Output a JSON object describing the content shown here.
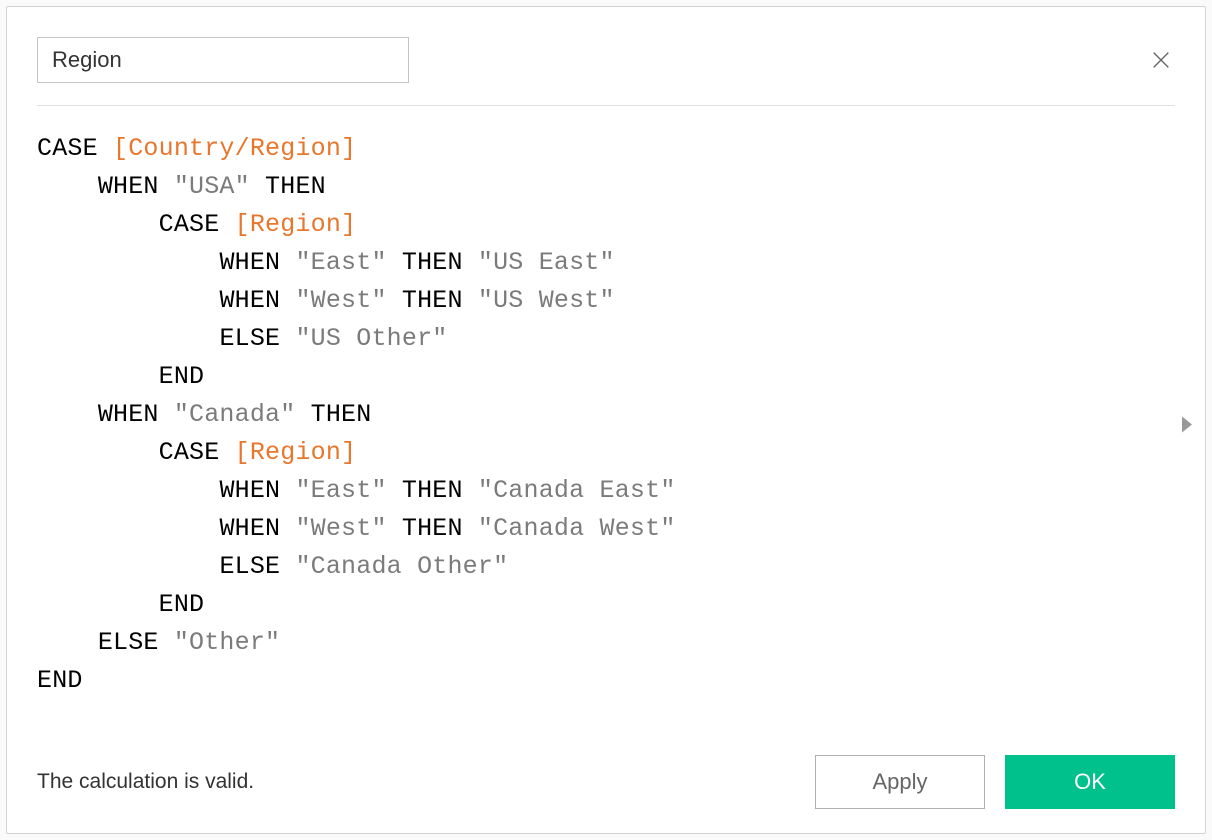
{
  "calc_name": "Region",
  "formula": {
    "lines": [
      {
        "indent": 0,
        "tokens": [
          {
            "t": "kw",
            "v": "CASE "
          },
          {
            "t": "field",
            "v": "[Country/Region]"
          }
        ]
      },
      {
        "indent": 1,
        "tokens": [
          {
            "t": "kw",
            "v": "WHEN "
          },
          {
            "t": "str",
            "v": "\"USA\""
          },
          {
            "t": "kw",
            "v": " THEN"
          }
        ]
      },
      {
        "indent": 2,
        "tokens": [
          {
            "t": "kw",
            "v": "CASE "
          },
          {
            "t": "field",
            "v": "[Region]"
          }
        ]
      },
      {
        "indent": 3,
        "tokens": [
          {
            "t": "kw",
            "v": "WHEN "
          },
          {
            "t": "str",
            "v": "\"East\""
          },
          {
            "t": "kw",
            "v": " THEN "
          },
          {
            "t": "str",
            "v": "\"US East\""
          }
        ]
      },
      {
        "indent": 3,
        "tokens": [
          {
            "t": "kw",
            "v": "WHEN "
          },
          {
            "t": "str",
            "v": "\"West\""
          },
          {
            "t": "kw",
            "v": " THEN "
          },
          {
            "t": "str",
            "v": "\"US West\""
          }
        ]
      },
      {
        "indent": 3,
        "tokens": [
          {
            "t": "kw",
            "v": "ELSE "
          },
          {
            "t": "str",
            "v": "\"US Other\""
          }
        ]
      },
      {
        "indent": 2,
        "tokens": [
          {
            "t": "kw",
            "v": "END"
          }
        ]
      },
      {
        "indent": 1,
        "tokens": [
          {
            "t": "kw",
            "v": "WHEN "
          },
          {
            "t": "str",
            "v": "\"Canada\""
          },
          {
            "t": "kw",
            "v": " THEN"
          }
        ]
      },
      {
        "indent": 2,
        "tokens": [
          {
            "t": "kw",
            "v": "CASE "
          },
          {
            "t": "field",
            "v": "[Region]"
          }
        ]
      },
      {
        "indent": 3,
        "tokens": [
          {
            "t": "kw",
            "v": "WHEN "
          },
          {
            "t": "str",
            "v": "\"East\""
          },
          {
            "t": "kw",
            "v": " THEN "
          },
          {
            "t": "str",
            "v": "\"Canada East\""
          }
        ]
      },
      {
        "indent": 3,
        "tokens": [
          {
            "t": "kw",
            "v": "WHEN "
          },
          {
            "t": "str",
            "v": "\"West\""
          },
          {
            "t": "kw",
            "v": " THEN "
          },
          {
            "t": "str",
            "v": "\"Canada West\""
          }
        ]
      },
      {
        "indent": 3,
        "tokens": [
          {
            "t": "kw",
            "v": "ELSE "
          },
          {
            "t": "str",
            "v": "\"Canada Other\""
          }
        ]
      },
      {
        "indent": 2,
        "tokens": [
          {
            "t": "kw",
            "v": "END"
          }
        ]
      },
      {
        "indent": 1,
        "tokens": [
          {
            "t": "kw",
            "v": "ELSE "
          },
          {
            "t": "str",
            "v": "\"Other\""
          }
        ]
      },
      {
        "indent": 0,
        "tokens": [
          {
            "t": "kw",
            "v": "END"
          }
        ]
      }
    ]
  },
  "status_text": "The calculation is valid.",
  "buttons": {
    "apply": "Apply",
    "ok": "OK"
  }
}
